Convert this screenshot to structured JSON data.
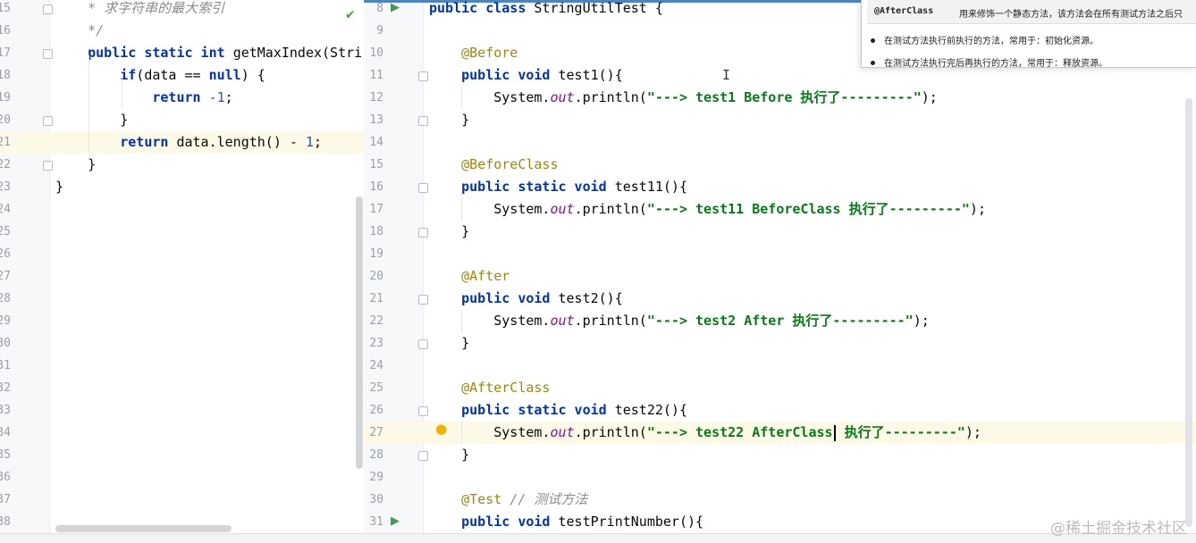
{
  "left_editor": {
    "lines": [
      {
        "n": "15",
        "segs": [
          [
            "cm",
            "    * 求字符串的最大索引"
          ]
        ]
      },
      {
        "n": "16",
        "segs": [
          [
            "cm",
            "    */"
          ]
        ]
      },
      {
        "n": "17",
        "segs": [
          [
            "p",
            "    "
          ],
          [
            "kw",
            "public static int "
          ],
          [
            "p",
            "getMaxIndex(Stri"
          ]
        ]
      },
      {
        "n": "18",
        "segs": [
          [
            "p",
            "        "
          ],
          [
            "kw",
            "if"
          ],
          [
            "p",
            "(data == "
          ],
          [
            "kw",
            "null"
          ],
          [
            "p",
            ") {"
          ]
        ]
      },
      {
        "n": "19",
        "segs": [
          [
            "p",
            "            "
          ],
          [
            "kw",
            "return "
          ],
          [
            "num",
            "-1"
          ],
          [
            "p",
            ";"
          ]
        ]
      },
      {
        "n": "20",
        "segs": [
          [
            "p",
            "        }"
          ]
        ]
      },
      {
        "n": "21",
        "segs": [
          [
            "p",
            "        "
          ],
          [
            "kw",
            "return "
          ],
          [
            "p",
            "data.length() - "
          ],
          [
            "num",
            "1"
          ],
          [
            "p",
            ";"
          ]
        ]
      },
      {
        "n": "22",
        "segs": [
          [
            "p",
            "    }"
          ]
        ]
      },
      {
        "n": "23",
        "segs": [
          [
            "p",
            "}"
          ]
        ]
      },
      {
        "n": "24",
        "segs": []
      },
      {
        "n": "25",
        "segs": []
      },
      {
        "n": "26",
        "segs": []
      },
      {
        "n": "27",
        "segs": []
      },
      {
        "n": "28",
        "segs": []
      },
      {
        "n": "29",
        "segs": []
      },
      {
        "n": "30",
        "segs": []
      },
      {
        "n": "31",
        "segs": []
      },
      {
        "n": "32",
        "segs": []
      },
      {
        "n": "33",
        "segs": []
      },
      {
        "n": "34",
        "segs": []
      },
      {
        "n": "35",
        "segs": []
      },
      {
        "n": "36",
        "segs": []
      },
      {
        "n": "37",
        "segs": []
      },
      {
        "n": "38",
        "segs": []
      }
    ]
  },
  "right_editor": {
    "lines": [
      {
        "n": "8",
        "segs": [
          [
            "kw",
            "public class "
          ],
          [
            "p",
            "StringUtilTest {"
          ]
        ]
      },
      {
        "n": "9",
        "segs": []
      },
      {
        "n": "10",
        "segs": [
          [
            "p",
            "    "
          ],
          [
            "an",
            "@Before"
          ]
        ]
      },
      {
        "n": "11",
        "segs": [
          [
            "p",
            "    "
          ],
          [
            "kw",
            "public void "
          ],
          [
            "p",
            "test1(){"
          ]
        ]
      },
      {
        "n": "12",
        "segs": [
          [
            "p",
            "        System."
          ],
          [
            "it",
            "out"
          ],
          [
            "p",
            ".println("
          ],
          [
            "str",
            "\"---> test1 Before 执行了---------\""
          ],
          [
            "p",
            ");"
          ]
        ]
      },
      {
        "n": "13",
        "segs": [
          [
            "p",
            "    }"
          ]
        ]
      },
      {
        "n": "14",
        "segs": []
      },
      {
        "n": "15",
        "segs": [
          [
            "p",
            "    "
          ],
          [
            "an",
            "@BeforeClass"
          ]
        ]
      },
      {
        "n": "16",
        "segs": [
          [
            "p",
            "    "
          ],
          [
            "kw",
            "public static void "
          ],
          [
            "p",
            "test11(){"
          ]
        ]
      },
      {
        "n": "17",
        "segs": [
          [
            "p",
            "        System."
          ],
          [
            "it",
            "out"
          ],
          [
            "p",
            ".println("
          ],
          [
            "str",
            "\"---> test11 BeforeClass 执行了---------\""
          ],
          [
            "p",
            ");"
          ]
        ]
      },
      {
        "n": "18",
        "segs": [
          [
            "p",
            "    }"
          ]
        ]
      },
      {
        "n": "19",
        "segs": []
      },
      {
        "n": "20",
        "segs": [
          [
            "p",
            "    "
          ],
          [
            "an",
            "@After"
          ]
        ]
      },
      {
        "n": "21",
        "segs": [
          [
            "p",
            "    "
          ],
          [
            "kw",
            "public void "
          ],
          [
            "p",
            "test2(){"
          ]
        ]
      },
      {
        "n": "22",
        "segs": [
          [
            "p",
            "        System."
          ],
          [
            "it",
            "out"
          ],
          [
            "p",
            ".println("
          ],
          [
            "str",
            "\"---> test2 After 执行了---------\""
          ],
          [
            "p",
            ");"
          ]
        ]
      },
      {
        "n": "23",
        "segs": [
          [
            "p",
            "    }"
          ]
        ]
      },
      {
        "n": "24",
        "segs": []
      },
      {
        "n": "25",
        "segs": [
          [
            "p",
            "    "
          ],
          [
            "an",
            "@AfterClass"
          ]
        ]
      },
      {
        "n": "26",
        "segs": [
          [
            "p",
            "    "
          ],
          [
            "kw",
            "public static void "
          ],
          [
            "p",
            "test22(){"
          ]
        ]
      },
      {
        "n": "27",
        "segs": [
          [
            "p",
            "        System."
          ],
          [
            "it",
            "out"
          ],
          [
            "p",
            ".println("
          ],
          [
            "str",
            "\"---> test22 AfterClass"
          ],
          [
            "caret",
            ""
          ],
          [
            "str",
            " 执行了---------\""
          ],
          [
            "p",
            ");"
          ]
        ]
      },
      {
        "n": "28",
        "segs": [
          [
            "p",
            "    }"
          ]
        ]
      },
      {
        "n": "29",
        "segs": []
      },
      {
        "n": "30",
        "segs": [
          [
            "p",
            "    "
          ],
          [
            "an",
            "@Test"
          ],
          [
            "p",
            " "
          ],
          [
            "cm",
            "// 测试方法"
          ]
        ]
      },
      {
        "n": "31",
        "segs": [
          [
            "p",
            "    "
          ],
          [
            "kw",
            "public void "
          ],
          [
            "p",
            "testPrintNumber(){"
          ]
        ]
      }
    ]
  },
  "tooltip": {
    "annotation": "@AfterClass",
    "description": "用来修饰一个静态方法，该方法会在所有测试方法之后只",
    "bullet1": "在测试方法执行前执行的方法，常用于：初始化资源。",
    "bullet2": "在测试方法执行完后再执行的方法，常用于：释放资源。"
  },
  "watermark": "@稀土掘金技术社区",
  "icons": [
    "check-icon",
    "run-gutter-icon",
    "lightbulb-icon",
    "fold-marker-icon"
  ],
  "colors": {
    "keyword": "#0033b3",
    "annotation": "#9e880d",
    "string": "#067d17",
    "number": "#1750eb",
    "highlight": "#fcf9e6"
  }
}
